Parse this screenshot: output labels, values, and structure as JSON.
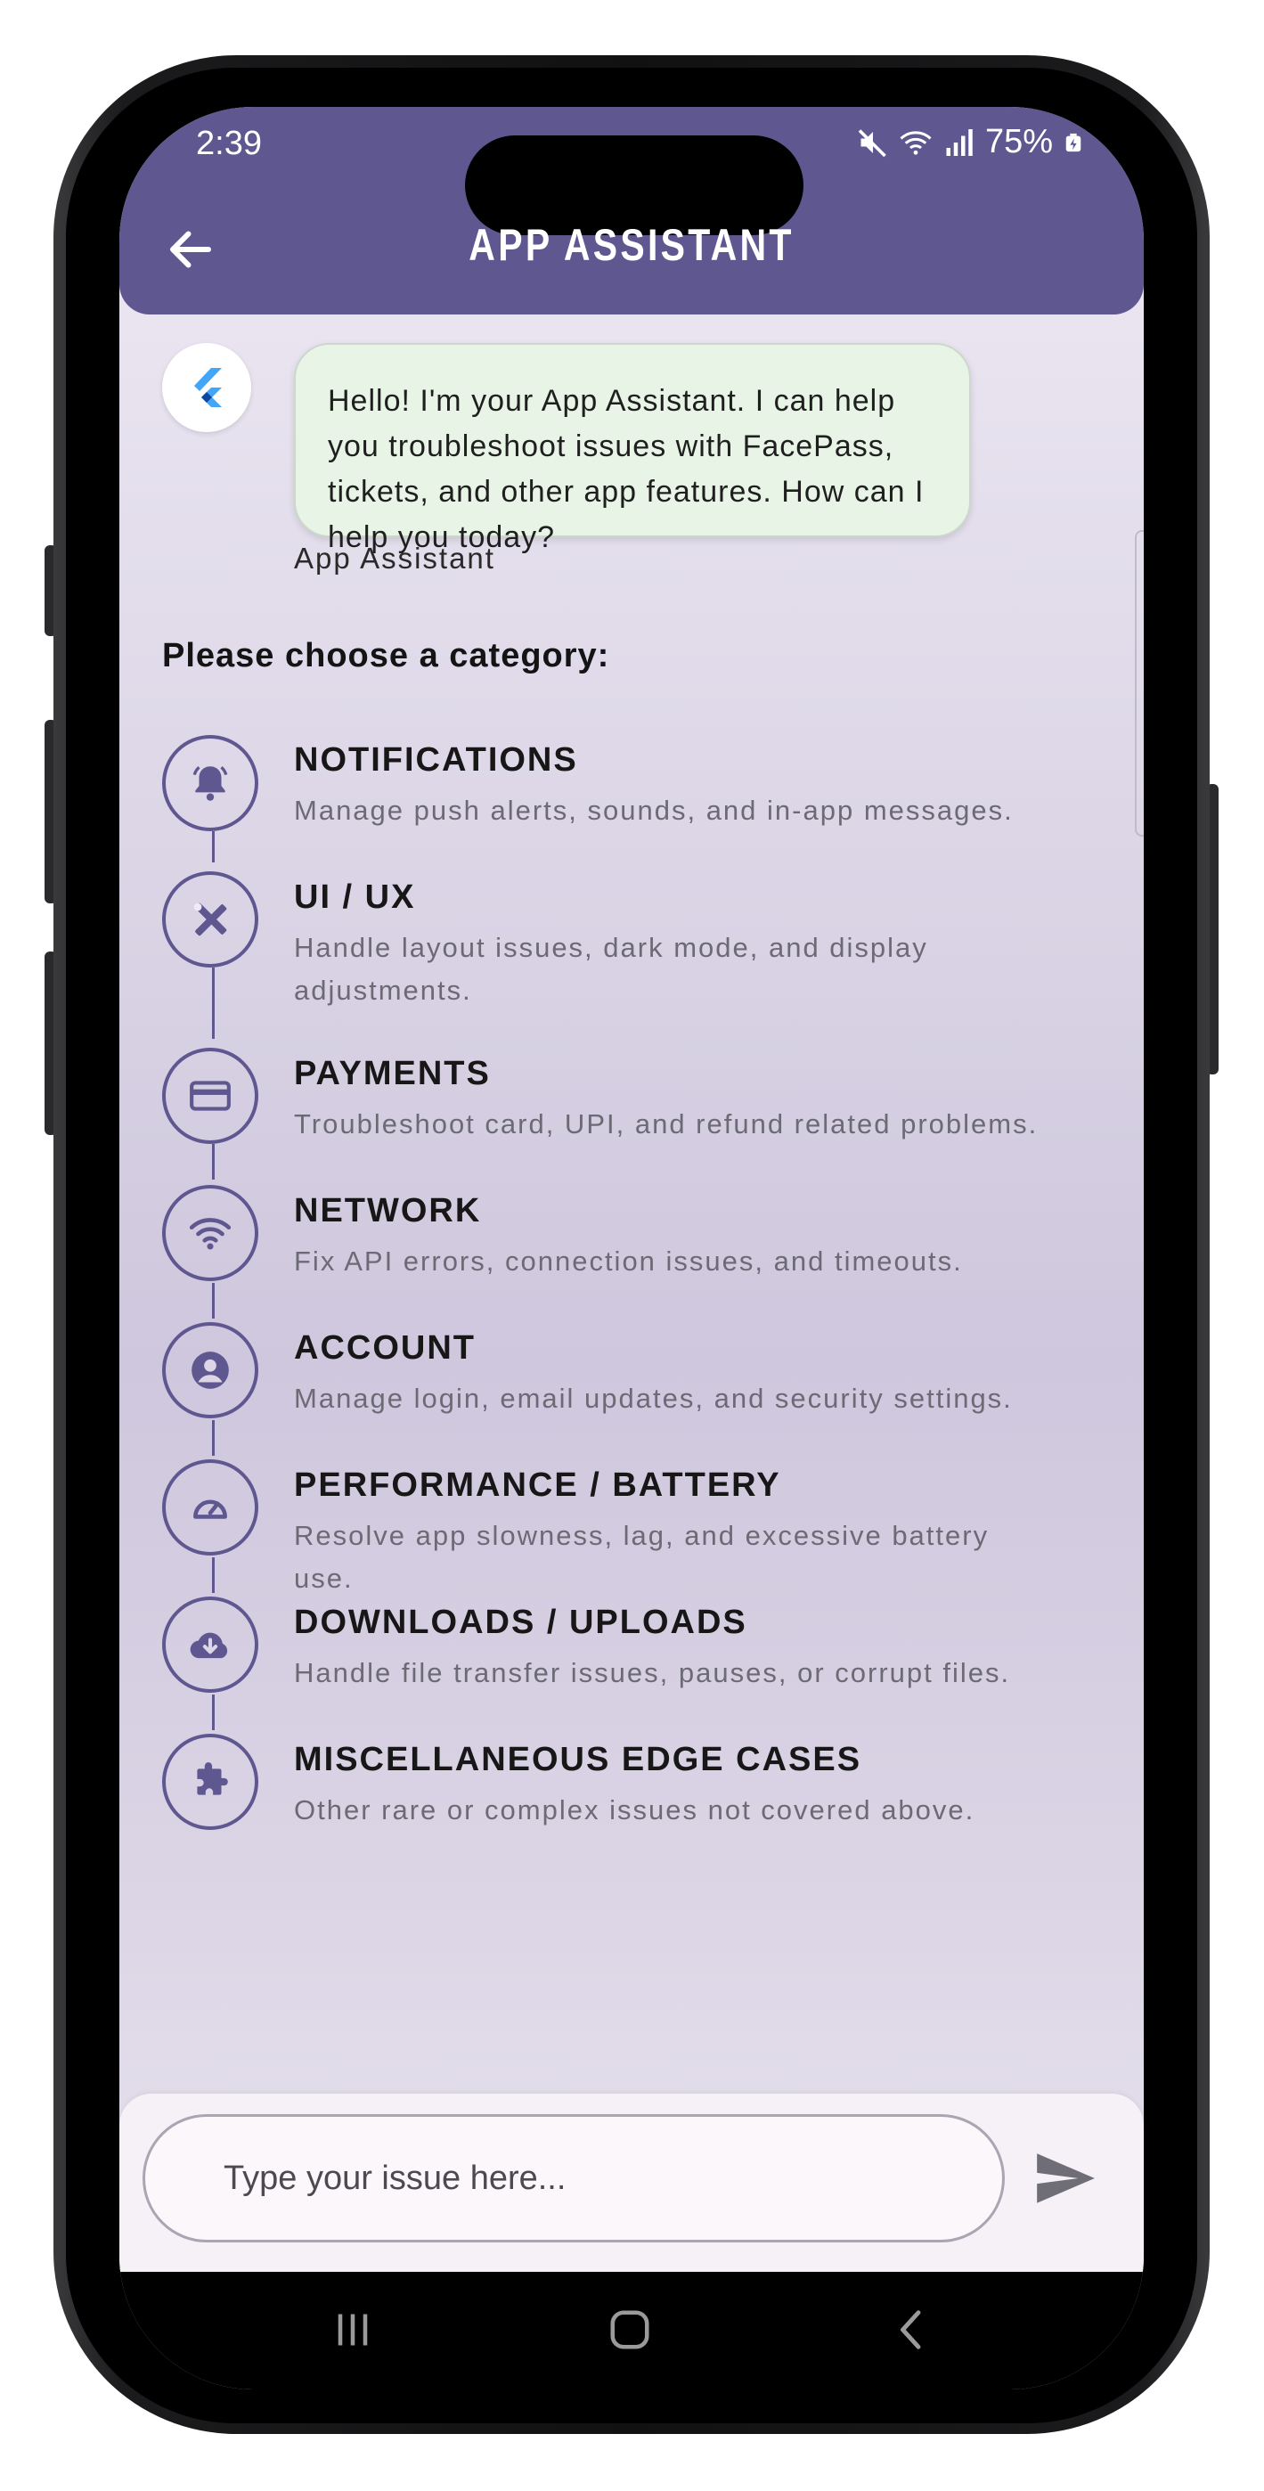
{
  "status_bar": {
    "time": "2:39",
    "battery": "75%"
  },
  "header": {
    "title": "APP ASSISTANT"
  },
  "chat": {
    "message": "Hello! I'm your App Assistant. I can help you troubleshoot issues with FacePass, tickets, and other app features. How can I help you today?",
    "sender": "App Assistant"
  },
  "categories_heading": "Please choose a category:",
  "categories": [
    {
      "title": "NOTIFICATIONS",
      "desc": "Manage push alerts, sounds, and in-app messages.",
      "icon": "bell-icon"
    },
    {
      "title": "UI / UX",
      "desc": "Handle layout issues, dark mode, and display adjustments.",
      "icon": "design-tools-icon"
    },
    {
      "title": "PAYMENTS",
      "desc": "Troubleshoot card, UPI, and refund related problems.",
      "icon": "credit-card-icon"
    },
    {
      "title": "NETWORK",
      "desc": "Fix API errors, connection issues, and timeouts.",
      "icon": "wifi-icon"
    },
    {
      "title": "ACCOUNT",
      "desc": "Manage login, email updates, and security settings.",
      "icon": "account-circle-icon"
    },
    {
      "title": "PERFORMANCE / BATTERY",
      "desc": "Resolve app slowness, lag, and excessive battery use.",
      "icon": "speedometer-icon"
    },
    {
      "title": "DOWNLOADS / UPLOADS",
      "desc": "Handle file transfer issues, pauses, or corrupt files.",
      "icon": "cloud-download-icon"
    },
    {
      "title": "MISCELLANEOUS EDGE CASES",
      "desc": "Other rare or complex issues not covered above.",
      "icon": "puzzle-icon"
    }
  ],
  "input": {
    "placeholder": "Type your issue here..."
  },
  "colors": {
    "primary": "#5f5790",
    "bubble": "#e8f5e6"
  }
}
